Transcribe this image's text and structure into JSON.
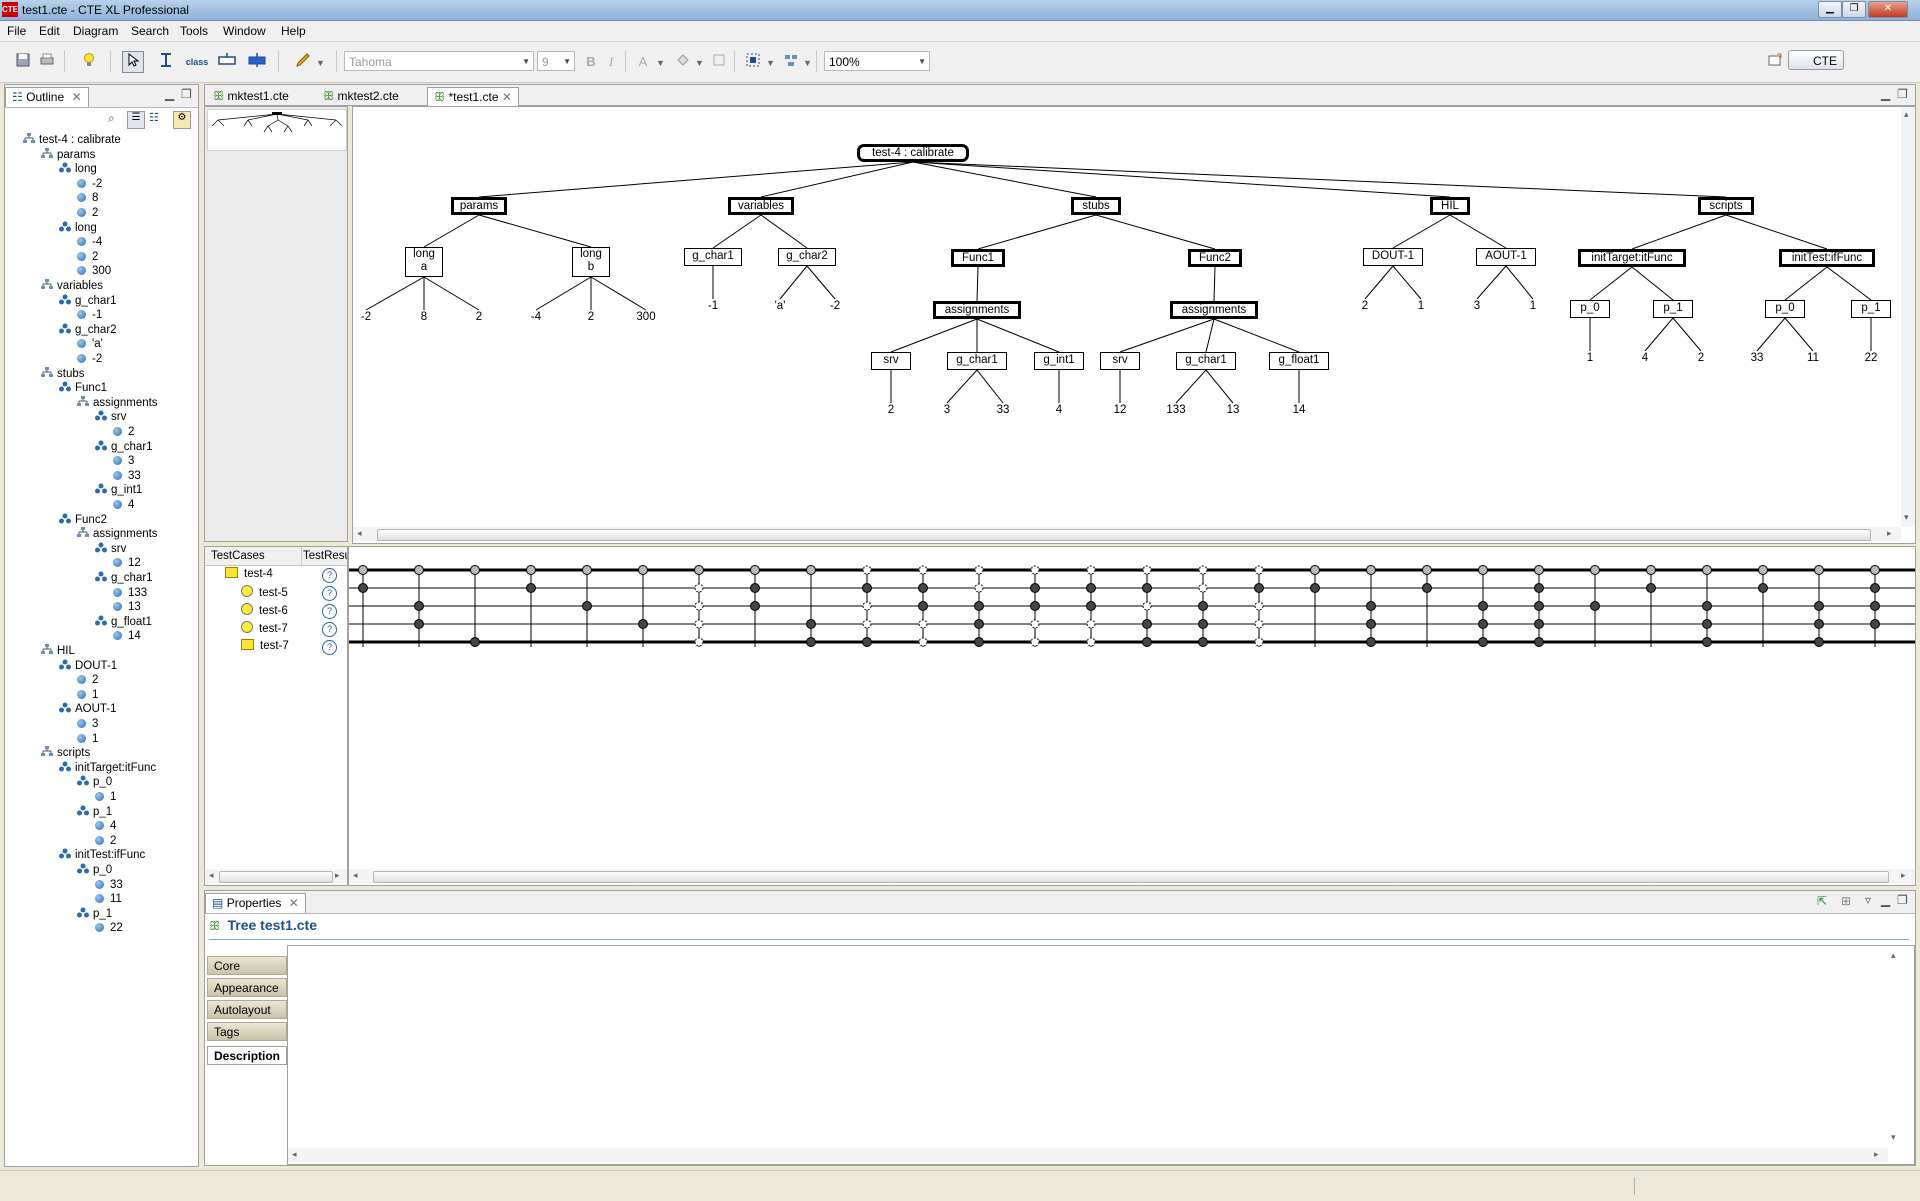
{
  "window": {
    "title": "test1.cte - CTE XL Professional",
    "app_icon_text": "CTE"
  },
  "menu": [
    "File",
    "Edit",
    "Diagram",
    "Search",
    "Tools",
    "Window",
    "Help"
  ],
  "toolbar": {
    "font_name": "Tahoma",
    "font_size": "9",
    "zoom": "100%",
    "perspective": "CTE",
    "bold": "B",
    "italic": "I",
    "font_color": "A",
    "class_label": "class"
  },
  "outline": {
    "tab_label": "Outline",
    "rows": [
      {
        "label": "test-4 : calibrate",
        "depth": 0,
        "kind": "tree"
      },
      {
        "label": "params",
        "depth": 1,
        "kind": "comp"
      },
      {
        "label": "long",
        "depth": 2,
        "kind": "cls"
      },
      {
        "label": "-2",
        "depth": 3,
        "kind": "leaf"
      },
      {
        "label": "8",
        "depth": 3,
        "kind": "leaf"
      },
      {
        "label": "2",
        "depth": 3,
        "kind": "leaf"
      },
      {
        "label": "long",
        "depth": 2,
        "kind": "cls"
      },
      {
        "label": "-4",
        "depth": 3,
        "kind": "leaf"
      },
      {
        "label": "2",
        "depth": 3,
        "kind": "leaf"
      },
      {
        "label": "300",
        "depth": 3,
        "kind": "leaf"
      },
      {
        "label": "variables",
        "depth": 1,
        "kind": "comp"
      },
      {
        "label": "g_char1",
        "depth": 2,
        "kind": "cls"
      },
      {
        "label": "-1",
        "depth": 3,
        "kind": "leaf"
      },
      {
        "label": "g_char2",
        "depth": 2,
        "kind": "cls"
      },
      {
        "label": "'a'",
        "depth": 3,
        "kind": "leaf"
      },
      {
        "label": "-2",
        "depth": 3,
        "kind": "leaf"
      },
      {
        "label": "stubs",
        "depth": 1,
        "kind": "comp"
      },
      {
        "label": "Func1",
        "depth": 2,
        "kind": "cls"
      },
      {
        "label": "assignments",
        "depth": 3,
        "kind": "comp"
      },
      {
        "label": "srv",
        "depth": 4,
        "kind": "cls"
      },
      {
        "label": "2",
        "depth": 5,
        "kind": "leaf"
      },
      {
        "label": "g_char1",
        "depth": 4,
        "kind": "cls"
      },
      {
        "label": "3",
        "depth": 5,
        "kind": "leaf"
      },
      {
        "label": "33",
        "depth": 5,
        "kind": "leaf"
      },
      {
        "label": "g_int1",
        "depth": 4,
        "kind": "cls"
      },
      {
        "label": "4",
        "depth": 5,
        "kind": "leaf"
      },
      {
        "label": "Func2",
        "depth": 2,
        "kind": "cls"
      },
      {
        "label": "assignments",
        "depth": 3,
        "kind": "comp"
      },
      {
        "label": "srv",
        "depth": 4,
        "kind": "cls"
      },
      {
        "label": "12",
        "depth": 5,
        "kind": "leaf"
      },
      {
        "label": "g_char1",
        "depth": 4,
        "kind": "cls"
      },
      {
        "label": "133",
        "depth": 5,
        "kind": "leaf"
      },
      {
        "label": "13",
        "depth": 5,
        "kind": "leaf"
      },
      {
        "label": "g_float1",
        "depth": 4,
        "kind": "cls"
      },
      {
        "label": "14",
        "depth": 5,
        "kind": "leaf"
      },
      {
        "label": "HIL",
        "depth": 1,
        "kind": "comp"
      },
      {
        "label": "DOUT-1",
        "depth": 2,
        "kind": "cls"
      },
      {
        "label": "2",
        "depth": 3,
        "kind": "leaf"
      },
      {
        "label": "1",
        "depth": 3,
        "kind": "leaf"
      },
      {
        "label": "AOUT-1",
        "depth": 2,
        "kind": "cls"
      },
      {
        "label": "3",
        "depth": 3,
        "kind": "leaf"
      },
      {
        "label": "1",
        "depth": 3,
        "kind": "leaf"
      },
      {
        "label": "scripts",
        "depth": 1,
        "kind": "comp"
      },
      {
        "label": "initTarget:itFunc",
        "depth": 2,
        "kind": "cls"
      },
      {
        "label": "p_0",
        "depth": 3,
        "kind": "cls"
      },
      {
        "label": "1",
        "depth": 4,
        "kind": "leaf"
      },
      {
        "label": "p_1",
        "depth": 3,
        "kind": "cls"
      },
      {
        "label": "4",
        "depth": 4,
        "kind": "leaf"
      },
      {
        "label": "2",
        "depth": 4,
        "kind": "leaf"
      },
      {
        "label": "initTest:ifFunc",
        "depth": 2,
        "kind": "cls"
      },
      {
        "label": "p_0",
        "depth": 3,
        "kind": "cls"
      },
      {
        "label": "33",
        "depth": 4,
        "kind": "leaf"
      },
      {
        "label": "11",
        "depth": 4,
        "kind": "leaf"
      },
      {
        "label": "p_1",
        "depth": 3,
        "kind": "cls"
      },
      {
        "label": "22",
        "depth": 4,
        "kind": "leaf"
      }
    ]
  },
  "editor_tabs": [
    "mktest1.cte",
    "mktest2.cte",
    "*test1.cte"
  ],
  "diagram": {
    "root": "test-4 : calibrate",
    "nodes": {
      "params": "params",
      "variables": "variables",
      "stubs": "stubs",
      "hil": "HIL",
      "scripts": "scripts",
      "long_a": "long\na",
      "long_b": "long\nb",
      "g_char1_v": "g_char1",
      "g_char2_v": "g_char2",
      "func1": "Func1",
      "func2": "Func2",
      "assign1": "assignments",
      "assign2": "assignments",
      "dout": "DOUT-1",
      "aout": "AOUT-1",
      "init_target": "initTarget:itFunc",
      "init_test": "initTest:ifFunc",
      "srv1": "srv",
      "gchar1_1": "g_char1",
      "gint1": "g_int1",
      "srv2": "srv",
      "gchar1_2": "g_char1",
      "gfloat1": "g_float1",
      "p0_a": "p_0",
      "p1_a": "p_1",
      "p0_b": "p_0",
      "p1_b": "p_1"
    },
    "classes": [
      "-2",
      "8",
      "2",
      "-4",
      "2",
      "300",
      "-1",
      "'a'",
      "-2",
      "2",
      "3",
      "33",
      "4",
      "12",
      "133",
      "13",
      "14",
      "2",
      "1",
      "3",
      "1",
      "1",
      "4",
      "2",
      "33",
      "11",
      "22"
    ]
  },
  "testcases": {
    "col_testcases": "TestCases",
    "col_testresult": "TestResu",
    "rows": [
      "test-4",
      "test-5",
      "test-6",
      "test-7",
      "test-7"
    ],
    "help_glyph": "?"
  },
  "properties": {
    "tab_label": "Properties",
    "title": "Tree test1.cte",
    "tabs": [
      "Core",
      "Appearance",
      "Autolayout",
      "Tags",
      "Description"
    ],
    "active_tab": "Description"
  },
  "colors": {
    "accent": "#1f4e8c",
    "selected_tab": "#ffffff",
    "testcase_yellow": "#ffef3a"
  }
}
